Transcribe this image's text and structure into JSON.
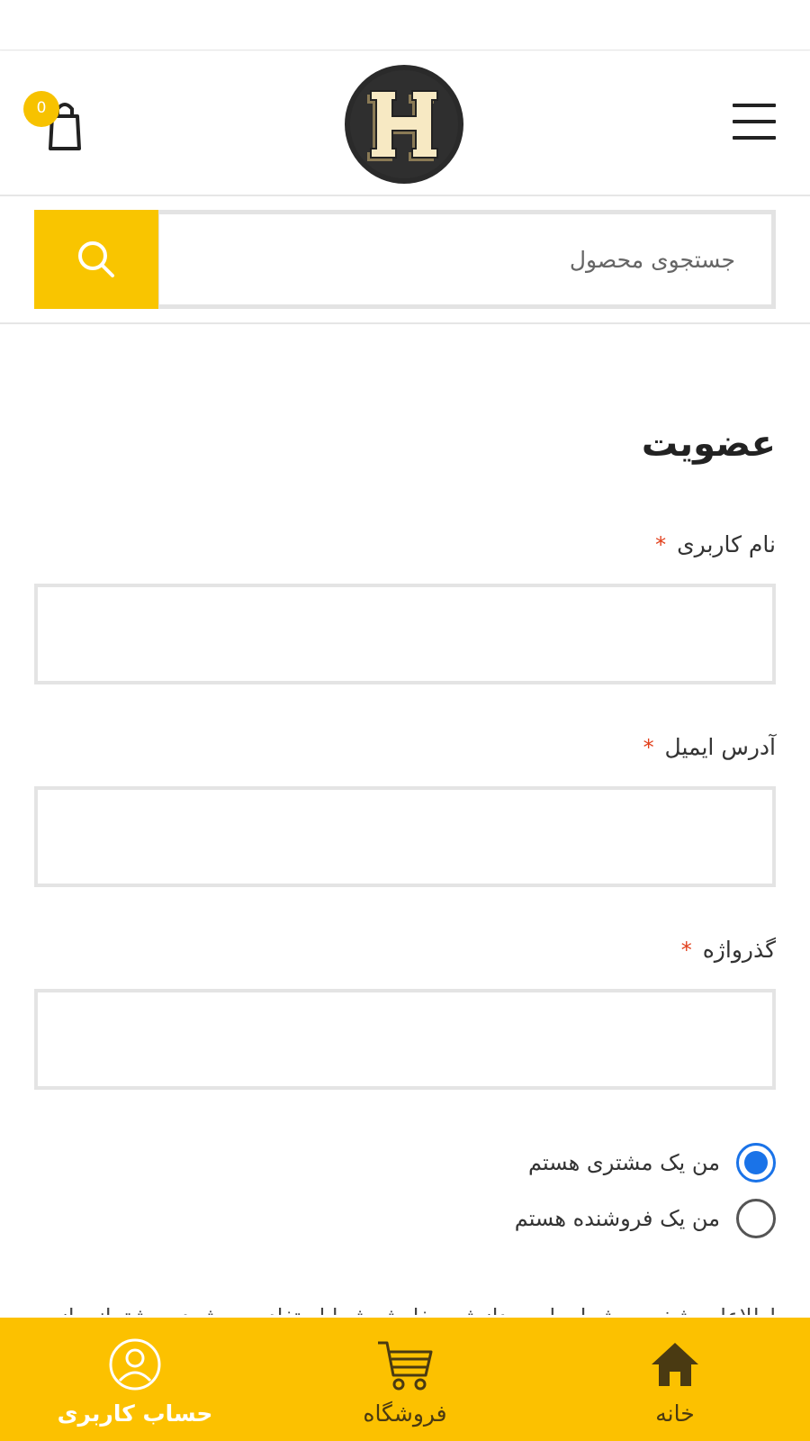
{
  "header": {
    "cart_count": "0",
    "logo_letter": "H"
  },
  "search": {
    "placeholder": "جستجوی محصول"
  },
  "form": {
    "title": "عضویت",
    "username_label": "نام کاربری",
    "email_label": "آدرس ایمیل",
    "password_label": "گذرواژه",
    "required_mark": "*",
    "role_options": [
      {
        "label": "من یک مشتری هستم",
        "selected": true
      },
      {
        "label": "من یک فروشنده هستم",
        "selected": false
      }
    ],
    "cutoff_text": "اطلاعات شخصی شما برای پردازش سفارش شما استفاده می‌شود و پشتیبانی از"
  },
  "bottom_nav": {
    "items": [
      {
        "label": "حساب کاربری",
        "icon": "user-circle-icon",
        "color": "#ffffff"
      },
      {
        "label": "فروشگاه",
        "icon": "shopping-cart-icon",
        "color": "#4a3a12"
      },
      {
        "label": "خانه",
        "icon": "home-icon",
        "color": "#4a3a12"
      }
    ]
  },
  "colors": {
    "accent": "#fcc100",
    "radio_selected": "#1a73e8",
    "required": "#e2401c"
  }
}
